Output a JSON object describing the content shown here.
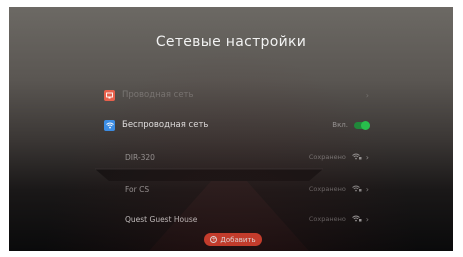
{
  "screen": {
    "title": "Сетевые настройки"
  },
  "wired": {
    "label": "Проводная сеть",
    "icon": "wired-network-icon",
    "color": "#e8604c"
  },
  "wireless": {
    "label": "Беспроводная сеть",
    "icon": "wifi-icon",
    "color": "#3b8fe8",
    "toggle_label": "Вкл.",
    "toggle_on": true,
    "toggle_color": "#28c04c"
  },
  "networks": [
    {
      "ssid": "DIR-320",
      "status": "Сохранено",
      "icon": "wifi-lock-icon"
    },
    {
      "ssid": "For CS",
      "status": "Сохранено",
      "icon": "wifi-lock-icon"
    },
    {
      "ssid": "Quest Guest House",
      "status": "Сохранено",
      "icon": "wifi-lock-icon"
    }
  ],
  "actions": {
    "add_label": "Добавить",
    "add_color": "#e0442f"
  }
}
